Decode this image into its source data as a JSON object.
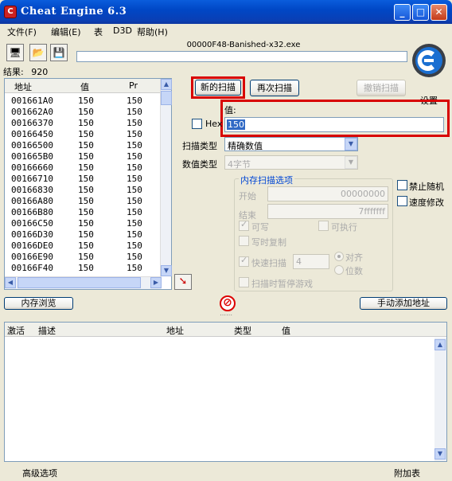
{
  "window": {
    "title": "Cheat Engine 6.3",
    "icon_glyph": "C"
  },
  "title_buttons": {
    "minimize": "_",
    "maximize": "□",
    "close": "✕"
  },
  "menu": [
    "文件(F)",
    "编辑(E)",
    "表",
    "D3D",
    "帮助(H)"
  ],
  "toolbar": {
    "open_process_glyph": "🖥",
    "open_glyph": "📂",
    "save_glyph": "💾"
  },
  "process": {
    "name": "00000F48-Banished-x32.exe"
  },
  "settings_label": "设置",
  "found": {
    "label": "结果:",
    "count": "920"
  },
  "results_list": {
    "columns": [
      "地址",
      "值",
      "Pr"
    ],
    "rows": [
      [
        "001661A0",
        "150",
        "150"
      ],
      [
        "001662A0",
        "150",
        "150"
      ],
      [
        "00166370",
        "150",
        "150"
      ],
      [
        "00166450",
        "150",
        "150"
      ],
      [
        "00166500",
        "150",
        "150"
      ],
      [
        "001665B0",
        "150",
        "150"
      ],
      [
        "00166660",
        "150",
        "150"
      ],
      [
        "00166710",
        "150",
        "150"
      ],
      [
        "00166830",
        "150",
        "150"
      ],
      [
        "00166A80",
        "150",
        "150"
      ],
      [
        "00166B80",
        "150",
        "150"
      ],
      [
        "00166C50",
        "150",
        "150"
      ],
      [
        "00166D30",
        "150",
        "150"
      ],
      [
        "00166DE0",
        "150",
        "150"
      ],
      [
        "00166E90",
        "150",
        "150"
      ],
      [
        "00166F40",
        "150",
        "150"
      ]
    ]
  },
  "scan": {
    "new_scan": "新的扫描",
    "next_scan": "再次扫描",
    "undo_scan": "撤销扫描",
    "value_label": "值:",
    "value": "150",
    "hex_label": "Hex",
    "scan_type_label": "扫描类型",
    "scan_type_value": "精确数值",
    "value_type_label": "数值类型",
    "value_type_value": "4字节"
  },
  "memory_options": {
    "title": "内存扫描选项",
    "start_label": "开始",
    "start_value": "00000000",
    "stop_label": "结束",
    "stop_value": "7fffffff",
    "writable": "可写",
    "executable": "可执行",
    "copy_on_write": "写时复制",
    "fast_scan": "快速扫描",
    "fast_scan_value": "4",
    "alignment": "对齐",
    "last_digits": "位数",
    "pause_game": "扫描时暂停游戏"
  },
  "extra_options": {
    "unrandomizer": "禁止随机",
    "speedhack": "速度修改"
  },
  "buttons": {
    "memory_view": "内存浏览",
    "add_address": "手动添加地址"
  },
  "address_table": {
    "columns": [
      "激活",
      "描述",
      "地址",
      "类型",
      "值"
    ]
  },
  "bottom": {
    "advanced": "高级选项",
    "table_extras": "附加表"
  },
  "colors": {
    "title_blue": "#0a5ddc",
    "highlight_red": "#d80000",
    "selection": "#316ac5"
  }
}
